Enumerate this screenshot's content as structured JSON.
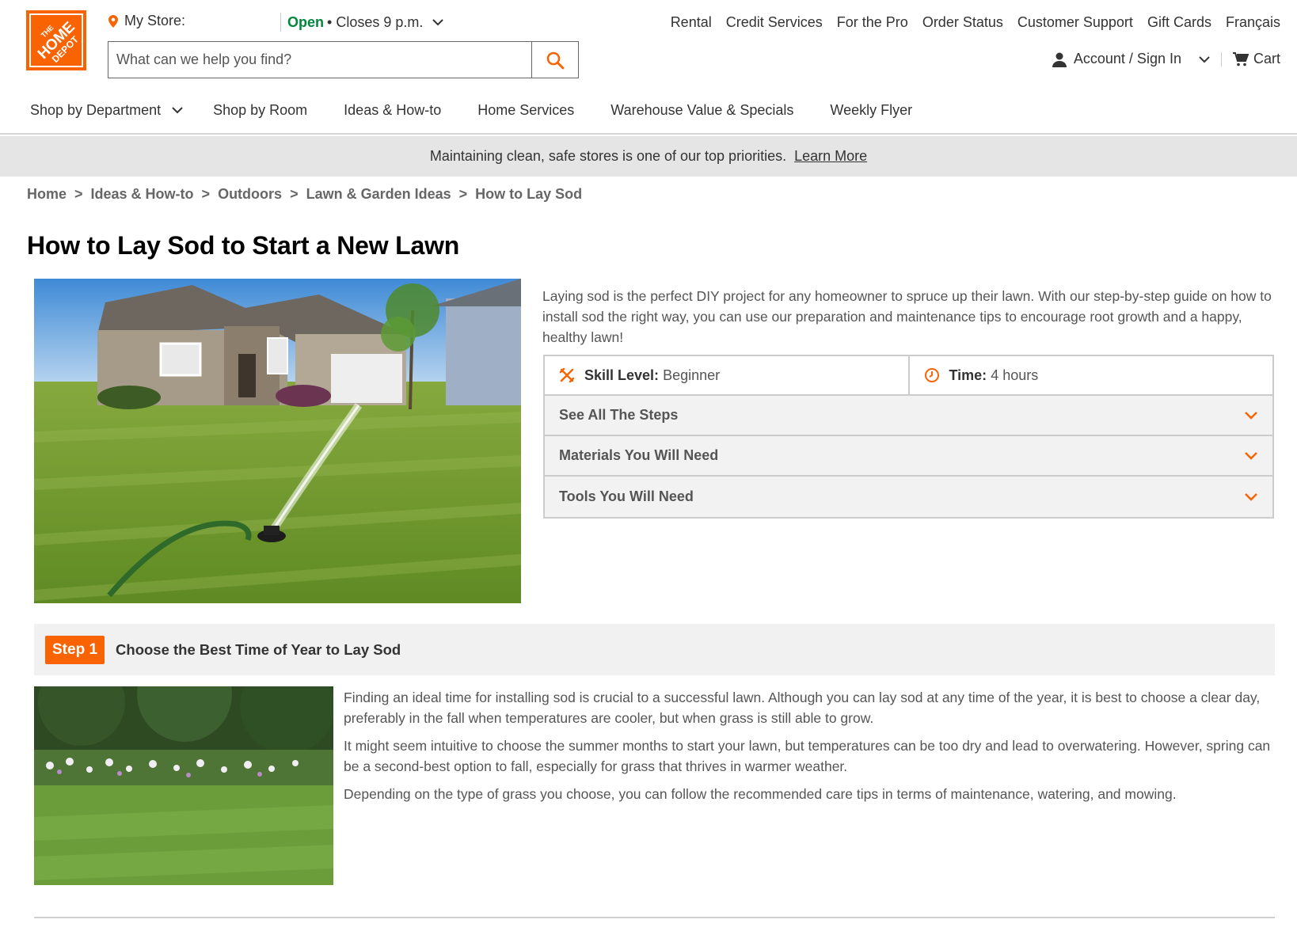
{
  "brand": {
    "accent": "#f96302",
    "open_color": "#00873c",
    "logo_text": "THE HOME DEPOT"
  },
  "store": {
    "label": "My Store:",
    "status_open": "Open",
    "status_rest": "• Closes 9 p.m."
  },
  "search": {
    "placeholder": "What can we help you find?"
  },
  "util_links": [
    "Rental",
    "Credit Services",
    "For the Pro",
    "Order Status",
    "Customer Support",
    "Gift Cards",
    "Français"
  ],
  "account": {
    "label": "Account / Sign In",
    "cart": "Cart"
  },
  "nav": {
    "items": [
      "Shop by Department",
      "Shop by Room",
      "Ideas & How-to",
      "Home Services",
      "Warehouse Value & Specials",
      "Weekly Flyer"
    ]
  },
  "banner": {
    "text": "Maintaining clean, safe stores is one of our top priorities.",
    "link": "Learn More"
  },
  "breadcrumb": [
    "Home",
    "Ideas & How-to",
    "Outdoors",
    "Lawn & Garden Ideas",
    "How to Lay Sod"
  ],
  "page_title": "How to Lay Sod to Start a New Lawn",
  "intro": "Laying sod is the perfect DIY project for any homeowner to spruce up their lawn. With our step-by-step guide on how to install sod the right way, you can use our preparation and maintenance tips to encourage root growth and a happy, healthy lawn!",
  "info": {
    "skill_label": "Skill Level:",
    "skill_value": "Beginner",
    "time_label": "Time:",
    "time_value": "4 hours",
    "accordions": [
      "See All The Steps",
      "Materials You Will Need",
      "Tools You Will Need"
    ]
  },
  "step1": {
    "badge": "Step 1",
    "title": "Choose the Best Time of Year to Lay Sod",
    "paragraphs": [
      "Finding an ideal time for installing sod is crucial to a successful lawn. Although you can lay sod at any time of the year, it is best to choose a clear day, preferably in the fall when temperatures are cooler, but when grass is still able to grow.",
      "It might seem intuitive to choose the summer months to start your lawn, but temperatures can be too dry and lead to overwatering. However, spring can be a second-best option to fall, especially for grass that thrives in warmer weather.",
      "Depending on the type of grass you choose, you can follow the recommended care tips in terms of maintenance, watering, and mowing."
    ]
  }
}
